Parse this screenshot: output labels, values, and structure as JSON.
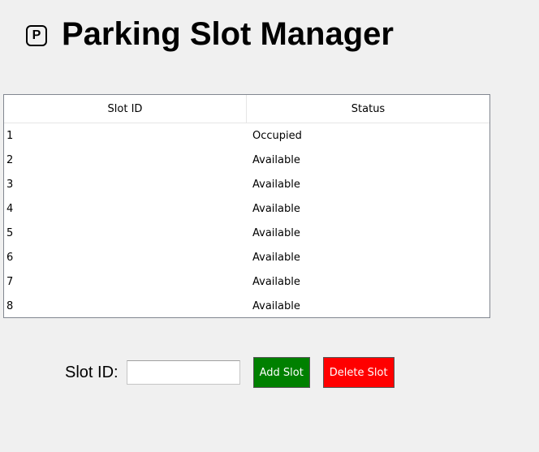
{
  "header": {
    "icon_letter": "P",
    "title": "Parking Slot Manager"
  },
  "table": {
    "columns": [
      "Slot ID",
      "Status"
    ],
    "rows": [
      {
        "id": "1",
        "status": "Occupied"
      },
      {
        "id": "2",
        "status": "Available"
      },
      {
        "id": "3",
        "status": "Available"
      },
      {
        "id": "4",
        "status": "Available"
      },
      {
        "id": "5",
        "status": "Available"
      },
      {
        "id": "6",
        "status": "Available"
      },
      {
        "id": "7",
        "status": "Available"
      },
      {
        "id": "8",
        "status": "Available"
      }
    ]
  },
  "form": {
    "slot_label": "Slot ID:",
    "slot_value": "",
    "add_label": "Add Slot",
    "delete_label": "Delete Slot"
  },
  "colors": {
    "background": "#f0f0f0",
    "add_button": "#008000",
    "delete_button": "#ff0000"
  }
}
